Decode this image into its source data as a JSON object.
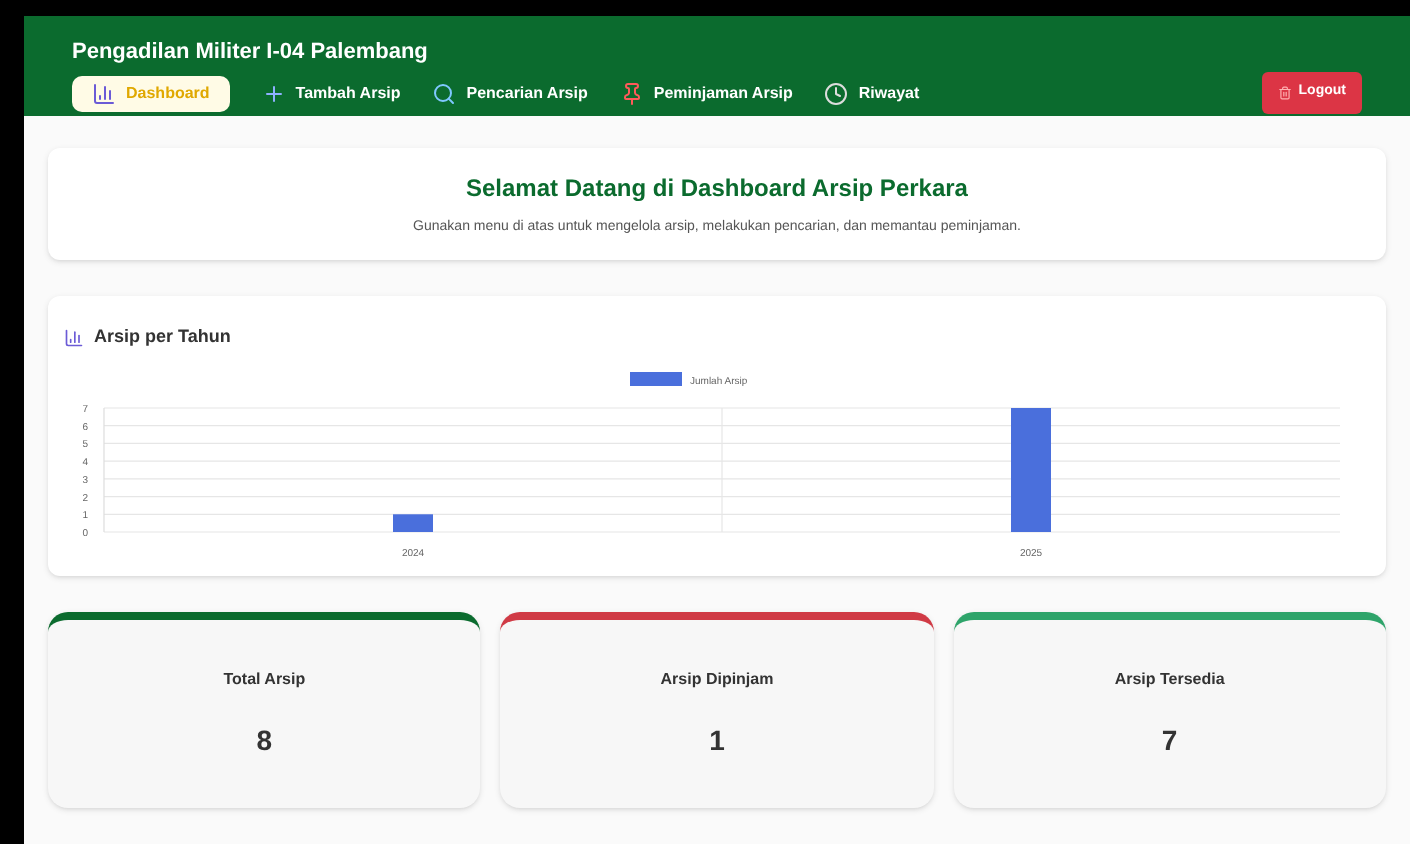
{
  "header": {
    "title": "Pengadilan Militer I-04 Palembang",
    "logout": "Logout"
  },
  "nav": [
    {
      "label": "Dashboard",
      "kind": "chart",
      "selected": true
    },
    {
      "label": "Tambah Arsip",
      "kind": "plus",
      "selected": false
    },
    {
      "label": "Pencarian Arsip",
      "kind": "search",
      "selected": false
    },
    {
      "label": "Peminjaman Arsip",
      "kind": "pin",
      "selected": false
    },
    {
      "label": "Riwayat",
      "kind": "history",
      "selected": false
    }
  ],
  "welcome": {
    "title": "Selamat Datang di Dashboard Arsip Perkara",
    "subtitle": "Gunakan menu di atas untuk mengelola arsip, melakukan pencarian, dan memantau peminjaman."
  },
  "chart_card": {
    "title": "Arsip per Tahun",
    "chart_data": {
      "type": "bar",
      "grid": true,
      "categories": [
        "2024",
        "2025"
      ],
      "series": [
        {
          "name": "Jumlah Arsip",
          "color": "#4a6fdc",
          "values": [
            1,
            7
          ]
        }
      ],
      "ylim": [
        0,
        7
      ],
      "yticks": [
        0,
        1,
        2,
        3,
        4,
        5,
        6,
        7
      ]
    }
  },
  "stats": [
    {
      "label": "Total Arsip",
      "value": "8",
      "color": "#0b6b2e"
    },
    {
      "label": "Arsip Dipinjam",
      "value": "1",
      "color": "#d03a45"
    },
    {
      "label": "Arsip Tersedia",
      "value": "7",
      "color": "#2ea46a"
    }
  ]
}
